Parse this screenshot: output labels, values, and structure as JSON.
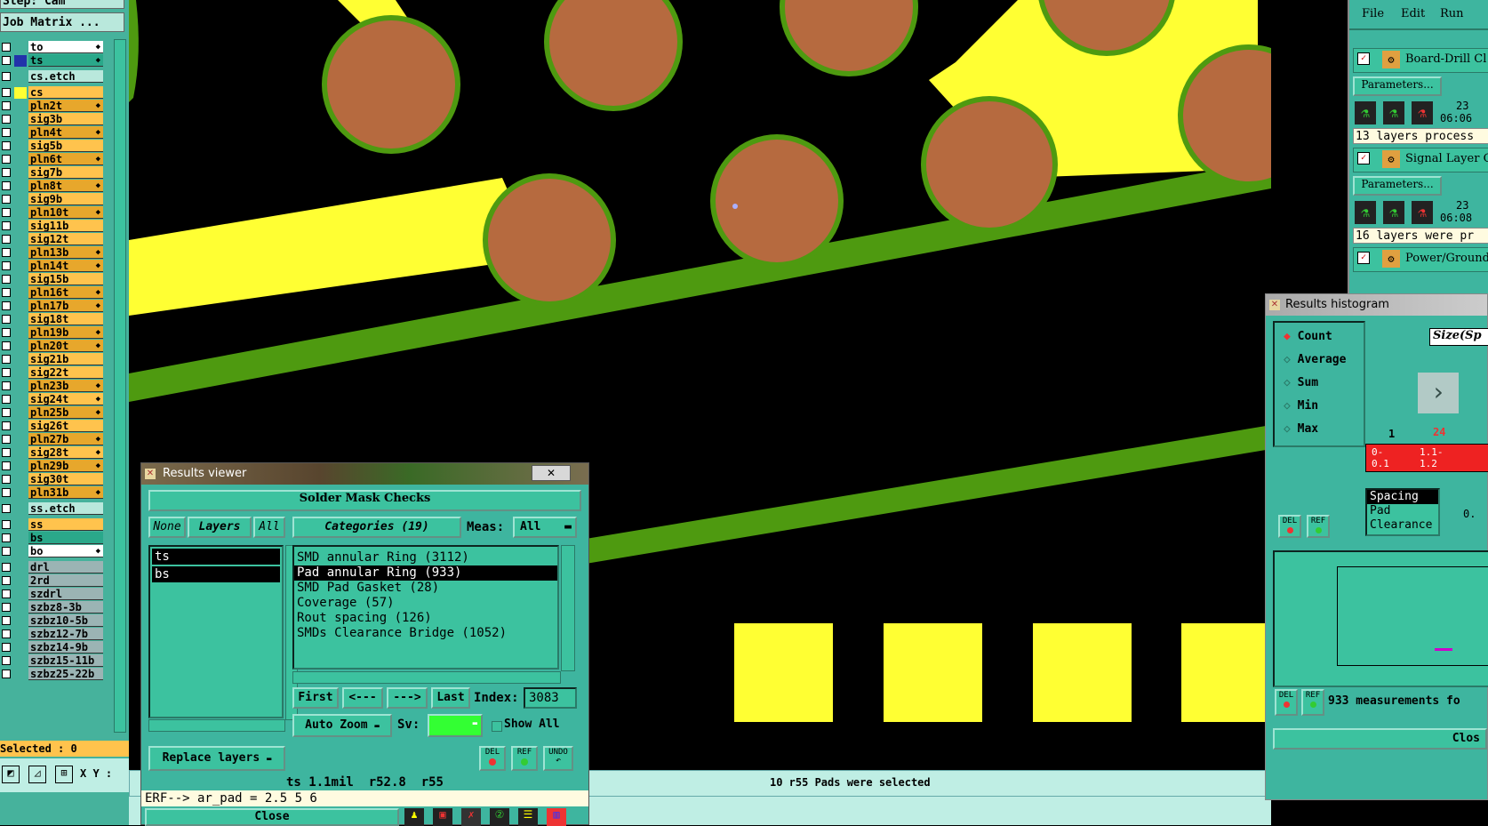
{
  "left_panel": {
    "header_title": "Step: Cam",
    "job_matrix_label": "Job Matrix ...",
    "layers": [
      {
        "name": "to",
        "bg": "#ffffff",
        "mark": "◆"
      },
      {
        "name": "ts",
        "bg": "#2aa88a",
        "mark": "◆",
        "selected": true
      },
      {
        "sep": true
      },
      {
        "name": "cs.etch",
        "bg": "#b9e8dc"
      },
      {
        "sep": true
      },
      {
        "name": "cs",
        "bg": "#ffc34d",
        "sel_color": "#ffff33"
      },
      {
        "name": "pln2t",
        "bg": "#e7a72c",
        "mark": "◆"
      },
      {
        "name": "sig3b",
        "bg": "#ffc34d"
      },
      {
        "name": "pln4t",
        "bg": "#e7a72c",
        "mark": "◆"
      },
      {
        "name": "sig5b",
        "bg": "#ffc34d"
      },
      {
        "name": "pln6t",
        "bg": "#e7a72c",
        "mark": "◆"
      },
      {
        "name": "sig7b",
        "bg": "#ffc34d"
      },
      {
        "name": "pln8t",
        "bg": "#e7a72c",
        "mark": "◆"
      },
      {
        "name": "sig9b",
        "bg": "#ffc34d"
      },
      {
        "name": "pln10t",
        "bg": "#e7a72c",
        "mark": "◆"
      },
      {
        "name": "sig11b",
        "bg": "#ffc34d"
      },
      {
        "name": "sig12t",
        "bg": "#ffc34d"
      },
      {
        "name": "pln13b",
        "bg": "#e7a72c",
        "mark": "◆"
      },
      {
        "name": "pln14t",
        "bg": "#e7a72c",
        "mark": "◆"
      },
      {
        "name": "sig15b",
        "bg": "#ffc34d"
      },
      {
        "name": "pln16t",
        "bg": "#e7a72c",
        "mark": "◆"
      },
      {
        "name": "pln17b",
        "bg": "#e7a72c",
        "mark": "◆"
      },
      {
        "name": "sig18t",
        "bg": "#ffc34d"
      },
      {
        "name": "pln19b",
        "bg": "#e7a72c",
        "mark": "◆"
      },
      {
        "name": "pln20t",
        "bg": "#e7a72c",
        "mark": "◆"
      },
      {
        "name": "sig21b",
        "bg": "#ffc34d"
      },
      {
        "name": "sig22t",
        "bg": "#ffc34d"
      },
      {
        "name": "pln23b",
        "bg": "#e7a72c",
        "mark": "◆"
      },
      {
        "name": "sig24t",
        "bg": "#ffc34d",
        "mark": "◆"
      },
      {
        "name": "pln25b",
        "bg": "#e7a72c",
        "mark": "◆"
      },
      {
        "name": "sig26t",
        "bg": "#ffc34d"
      },
      {
        "name": "pln27b",
        "bg": "#e7a72c",
        "mark": "◆"
      },
      {
        "name": "sig28t",
        "bg": "#ffc34d",
        "mark": "◆"
      },
      {
        "name": "pln29b",
        "bg": "#e7a72c",
        "mark": "◆"
      },
      {
        "name": "sig30t",
        "bg": "#ffc34d"
      },
      {
        "name": "pln31b",
        "bg": "#e7a72c",
        "mark": "◆"
      },
      {
        "sep": true
      },
      {
        "name": "ss.etch",
        "bg": "#b9e8dc"
      },
      {
        "sep": true
      },
      {
        "name": "ss",
        "bg": "#ffc34d"
      },
      {
        "name": "bs",
        "bg": "#2aa88a"
      },
      {
        "name": "bo",
        "bg": "#ffffff",
        "mark": "◆"
      },
      {
        "sep": true
      },
      {
        "name": "drl",
        "bg": "#9bb4b4"
      },
      {
        "name": "2rd",
        "bg": "#9bb4b4"
      },
      {
        "name": "szdrl",
        "bg": "#9bb4b4"
      },
      {
        "name": "szbz8-3b",
        "bg": "#9bb4b4"
      },
      {
        "name": "szbz10-5b",
        "bg": "#9bb4b4"
      },
      {
        "name": "szbz12-7b",
        "bg": "#9bb4b4"
      },
      {
        "name": "szbz14-9b",
        "bg": "#9bb4b4"
      },
      {
        "name": "szbz15-11b",
        "bg": "#9bb4b4"
      },
      {
        "name": "szbz25-22b",
        "bg": "#9bb4b4"
      }
    ],
    "selected_label": "Selected : 0",
    "xy_label": "X Y :"
  },
  "results_viewer": {
    "title": "Results viewer",
    "heading": "Solder Mask Checks",
    "none_label": "None",
    "layers_label": "Layers",
    "all_label": "All",
    "categories_label": "Categories (19)",
    "meas_label": "Meas:",
    "meas_value": "All",
    "layer_items": [
      "ts",
      "bs"
    ],
    "categories": [
      "SMD annular Ring (3112)",
      "Pad annular Ring (933)",
      "SMD Pad Gasket (28)",
      "Coverage (57)",
      "Rout spacing (126)",
      "SMDs Clearance Bridge (1052)"
    ],
    "first_label": "First",
    "prev_label": "<---",
    "next_label": "--->",
    "last_label": "Last",
    "index_label": "Index:",
    "index_value": "3083",
    "auto_zoom_label": "Auto Zoom",
    "sv_label": "Sv:",
    "show_all_label": "Show All",
    "replace_layers_label": "Replace layers",
    "del_label": "DEL",
    "ref_label": "REF",
    "undo_label": "UNDO",
    "measure_line": "ts 1.1mil  r52.8  r55",
    "erf_line": "ERF--> ar_pad = 2.5 5 6",
    "close_label": "Close"
  },
  "right_panel": {
    "menu": [
      "File",
      "Edit",
      "Run"
    ],
    "checks": [
      {
        "name": "Board-Drill Cl",
        "params_label": "Parameters...",
        "time1": "23",
        "time2": "06:06",
        "status": "13 layers process"
      },
      {
        "name": "Signal Layer C",
        "params_label": "Parameters...",
        "time1": "23",
        "time2": "06:08",
        "status": "16 layers were pr"
      },
      {
        "name": "Power/Ground"
      }
    ]
  },
  "histogram": {
    "title": "Results histogram",
    "options": [
      "Count",
      "Average",
      "Sum",
      "Min",
      "Max"
    ],
    "selected_option": "Count",
    "size_label": "Size(Sp",
    "bar_counts": [
      "1",
      "24"
    ],
    "bins": [
      "0-\n0.1",
      "1.1-\n1.2"
    ],
    "list_items": [
      "Spacing",
      "Pad",
      "Clearance"
    ],
    "scale_value": "0.",
    "measurements": "933 measurements fo",
    "close_label": "Clos",
    "del_label": "DEL",
    "ref_label": "REF"
  },
  "status_bar": {
    "message": "10 r55 Pads were selected"
  },
  "colors": {
    "copper": "#b66a3f",
    "mask_green": "#4e9a10",
    "yellow": "#ffff33",
    "panel": "#3eb59f"
  }
}
